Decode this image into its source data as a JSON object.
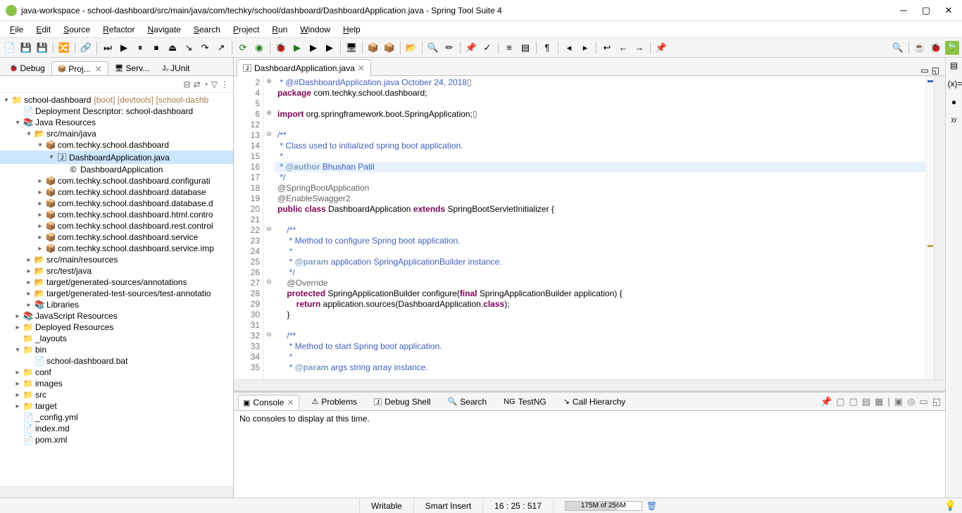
{
  "window": {
    "title": "java-workspace - school-dashboard/src/main/java/com/techky/school/dashboard/DashboardApplication.java - Spring Tool Suite 4"
  },
  "menu": {
    "items": [
      "File",
      "Edit",
      "Source",
      "Refactor",
      "Navigate",
      "Search",
      "Project",
      "Run",
      "Window",
      "Help"
    ]
  },
  "views": {
    "tabs": [
      {
        "label": "Debug",
        "icon": "🐞"
      },
      {
        "label": "Proj...",
        "icon": "📦",
        "active": true,
        "close": true
      },
      {
        "label": "Serv...",
        "icon": "🖥"
      },
      {
        "label": "JUnit",
        "icon": "Jᵤ"
      }
    ]
  },
  "tree": {
    "items": [
      {
        "ind": 0,
        "tw": "▾",
        "icon": "📁",
        "label": "school-dashboard",
        "dec": " [boot] [devtools] [school-dashb"
      },
      {
        "ind": 1,
        "tw": "",
        "icon": "📄",
        "label": "Deployment Descriptor: school-dashboard"
      },
      {
        "ind": 1,
        "tw": "▾",
        "icon": "📚",
        "label": "Java Resources"
      },
      {
        "ind": 2,
        "tw": "▾",
        "icon": "📂",
        "label": "src/main/java"
      },
      {
        "ind": 3,
        "tw": "▾",
        "icon": "📦",
        "label": "com.techky.school.dashboard"
      },
      {
        "ind": 4,
        "tw": "▾",
        "icon": "🄹",
        "label": "DashboardApplication.java",
        "selected": true
      },
      {
        "ind": 5,
        "tw": "",
        "icon": "©",
        "label": "DashboardApplication"
      },
      {
        "ind": 3,
        "tw": "▸",
        "icon": "📦",
        "label": "com.techky.school.dashboard.configurati"
      },
      {
        "ind": 3,
        "tw": "▸",
        "icon": "📦",
        "label": "com.techky.school.dashboard.database"
      },
      {
        "ind": 3,
        "tw": "▸",
        "icon": "📦",
        "label": "com.techky.school.dashboard.database.d"
      },
      {
        "ind": 3,
        "tw": "▸",
        "icon": "📦",
        "label": "com.techky.school.dashboard.html.contro"
      },
      {
        "ind": 3,
        "tw": "▸",
        "icon": "📦",
        "label": "com.techky.school.dashboard.rest.control"
      },
      {
        "ind": 3,
        "tw": "▸",
        "icon": "📦",
        "label": "com.techky.school.dashboard.service"
      },
      {
        "ind": 3,
        "tw": "▸",
        "icon": "📦",
        "label": "com.techky.school.dashboard.service.imp"
      },
      {
        "ind": 2,
        "tw": "▸",
        "icon": "📂",
        "label": "src/main/resources"
      },
      {
        "ind": 2,
        "tw": "▸",
        "icon": "📂",
        "label": "src/test/java"
      },
      {
        "ind": 2,
        "tw": "▸",
        "icon": "📂",
        "label": "target/generated-sources/annotations"
      },
      {
        "ind": 2,
        "tw": "▸",
        "icon": "📂",
        "label": "target/generated-test-sources/test-annotatio"
      },
      {
        "ind": 2,
        "tw": "▸",
        "icon": "📚",
        "label": "Libraries"
      },
      {
        "ind": 1,
        "tw": "▸",
        "icon": "📚",
        "label": "JavaScript Resources"
      },
      {
        "ind": 1,
        "tw": "▸",
        "icon": "📁",
        "label": "Deployed Resources"
      },
      {
        "ind": 1,
        "tw": "",
        "icon": "📁",
        "label": "_layouts"
      },
      {
        "ind": 1,
        "tw": "▾",
        "icon": "📁",
        "label": "bin"
      },
      {
        "ind": 2,
        "tw": "",
        "icon": "📄",
        "label": "school-dashboard.bat"
      },
      {
        "ind": 1,
        "tw": "▸",
        "icon": "📁",
        "label": "conf"
      },
      {
        "ind": 1,
        "tw": "▸",
        "icon": "📁",
        "label": "images"
      },
      {
        "ind": 1,
        "tw": "▸",
        "icon": "📁",
        "label": "src"
      },
      {
        "ind": 1,
        "tw": "▸",
        "icon": "📁",
        "label": "target"
      },
      {
        "ind": 1,
        "tw": "",
        "icon": "📄",
        "label": "_config.yml"
      },
      {
        "ind": 1,
        "tw": "",
        "icon": "📄",
        "label": "index.md"
      },
      {
        "ind": 1,
        "tw": "",
        "icon": "📄",
        "label": "pom.xml"
      }
    ]
  },
  "editor": {
    "tab": "DashboardApplication.java",
    "highlighted_line": 16,
    "gutter": [
      {
        "n": "2",
        "f": "⊕"
      },
      {
        "n": "4",
        "f": ""
      },
      {
        "n": "5",
        "f": ""
      },
      {
        "n": "6",
        "f": "⊕"
      },
      {
        "n": "12",
        "f": ""
      },
      {
        "n": "13",
        "f": "⊖"
      },
      {
        "n": "14",
        "f": ""
      },
      {
        "n": "15",
        "f": ""
      },
      {
        "n": "16",
        "f": ""
      },
      {
        "n": "17",
        "f": ""
      },
      {
        "n": "18",
        "f": ""
      },
      {
        "n": "19",
        "f": ""
      },
      {
        "n": "20",
        "f": ""
      },
      {
        "n": "21",
        "f": ""
      },
      {
        "n": "22",
        "f": "⊖"
      },
      {
        "n": "23",
        "f": ""
      },
      {
        "n": "24",
        "f": ""
      },
      {
        "n": "25",
        "f": ""
      },
      {
        "n": "26",
        "f": ""
      },
      {
        "n": "27",
        "f": "⊖"
      },
      {
        "n": "28",
        "f": ""
      },
      {
        "n": "29",
        "f": ""
      },
      {
        "n": "30",
        "f": ""
      },
      {
        "n": "31",
        "f": ""
      },
      {
        "n": "32",
        "f": "⊖"
      },
      {
        "n": "33",
        "f": ""
      },
      {
        "n": "34",
        "f": ""
      },
      {
        "n": "35",
        "f": ""
      }
    ],
    "lines": [
      {
        "html": "<span class='cm'> * @#DashboardApplication.java October 24, 2018</span><span class='an'>▯</span>"
      },
      {
        "html": "<span class='kw'>package</span> com.techky.school.dashboard;"
      },
      {
        "html": ""
      },
      {
        "html": "<span class='kw'>import</span> org.springframework.boot.SpringApplication;<span class='an'>▯</span>"
      },
      {
        "html": ""
      },
      {
        "html": "<span class='cm'>/**</span>"
      },
      {
        "html": "<span class='cm'> * Class used to initialized spring boot application.</span>"
      },
      {
        "html": "<span class='cm'> *</span>"
      },
      {
        "html": "<span class='cm'> * </span><span class='tag'>@author</span><span class='cm'> Bhushan Patil</span>"
      },
      {
        "html": "<span class='cm'> */</span>"
      },
      {
        "html": "<span class='an'>@SpringBootApplication</span>"
      },
      {
        "html": "<span class='an'>@EnableSwagger2</span>"
      },
      {
        "html": "<span class='kw'>public</span> <span class='kw'>class</span> DashboardApplication <span class='kw'>extends</span> SpringBootServletInitializer {"
      },
      {
        "html": ""
      },
      {
        "html": "    <span class='cm'>/**</span>"
      },
      {
        "html": "    <span class='cm'> * Method to configure Spring boot application.</span>"
      },
      {
        "html": "    <span class='cm'> *</span>"
      },
      {
        "html": "    <span class='cm'> * </span><span class='tag'>@param</span><span class='cm'> application SpringApplicationBuilder instance.</span>"
      },
      {
        "html": "    <span class='cm'> */</span>"
      },
      {
        "html": "    <span class='an'>@Override</span>"
      },
      {
        "html": "    <span class='kw'>protected</span> SpringApplicationBuilder configure(<span class='kw'>final</span> SpringApplicationBuilder application) {"
      },
      {
        "html": "        <span class='kw'>return</span> application.sources(DashboardApplication.<span class='kw'>class</span>);"
      },
      {
        "html": "    }"
      },
      {
        "html": ""
      },
      {
        "html": "    <span class='cm'>/**</span>"
      },
      {
        "html": "    <span class='cm'> * Method to start Spring boot application.</span>"
      },
      {
        "html": "    <span class='cm'> *</span>"
      },
      {
        "html": "    <span class='cm'> * </span><span class='tag'>@param</span><span class='cm'> args string array instance.</span>"
      }
    ]
  },
  "bottom": {
    "tabs": [
      {
        "label": "Console",
        "icon": "▣",
        "active": true,
        "close": true
      },
      {
        "label": "Problems",
        "icon": "⚠"
      },
      {
        "label": "Debug Shell",
        "icon": "🄹"
      },
      {
        "label": "Search",
        "icon": "🔍"
      },
      {
        "label": "TestNG",
        "icon": "NG"
      },
      {
        "label": "Call Hierarchy",
        "icon": "↘"
      }
    ],
    "message": "No consoles to display at this time."
  },
  "status": {
    "writable": "Writable",
    "insert": "Smart Insert",
    "cursor": "16 : 25 : 517",
    "heap": "175M of 256M"
  }
}
